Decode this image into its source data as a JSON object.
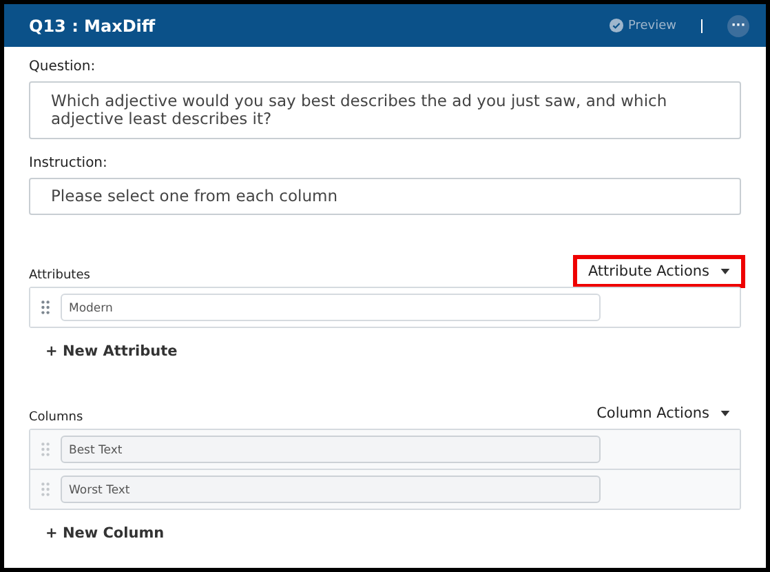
{
  "header": {
    "title": "Q13 : MaxDiff",
    "preview": {
      "label": "Preview",
      "disabled": true
    },
    "more": "···"
  },
  "question": {
    "label": "Question:",
    "value": "Which adjective would you say best describes the ad you just saw, and which adjective least describes it?"
  },
  "instruction": {
    "label": "Instruction:",
    "value": "Please select one from each column"
  },
  "sections": [
    {
      "label": "Attributes",
      "actions": {
        "label": "Attribute Actions",
        "highlighted": true
      },
      "items": [
        {
          "value": "Modern",
          "disabled": false
        }
      ],
      "add": "+ New Attribute"
    },
    {
      "label": "Columns",
      "actions": {
        "label": "Column Actions",
        "highlighted": false
      },
      "items": [
        {
          "value": "Best Text",
          "disabled": true
        },
        {
          "value": "Worst Text",
          "disabled": true
        }
      ],
      "add": "+ New Column"
    }
  ]
}
